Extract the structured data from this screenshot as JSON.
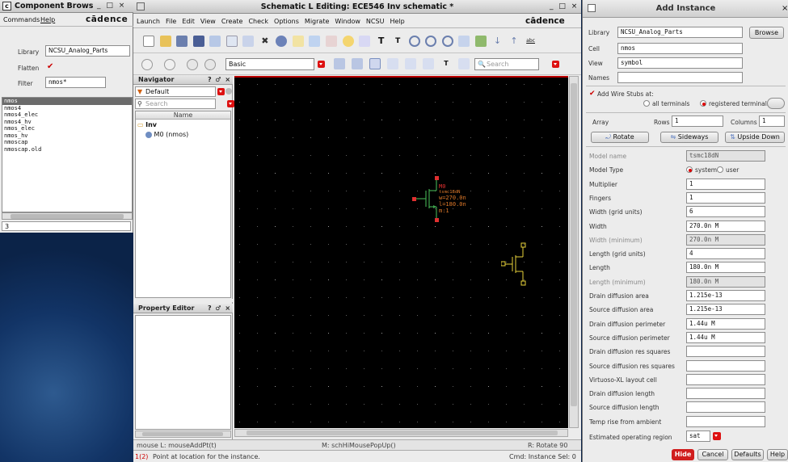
{
  "comp_browser": {
    "title": "Component Brows",
    "win_ctrls": "_ □ ×",
    "menu": [
      "Commands",
      "Help"
    ],
    "brand": "cādence",
    "library_label": "Library",
    "library_value": "NCSU_Analog_Parts",
    "flatten_label": "Flatten",
    "flatten_check": "✔",
    "filter_label": "Filter",
    "filter_value": "nmos*",
    "cells": [
      "nmos",
      "nmos4",
      "nmos4_elec",
      "nmos4_hv",
      "nmos_elec",
      "nmos_hv",
      "nmoscap",
      "nmoscap.old"
    ],
    "status_num": "3"
  },
  "main": {
    "title": "Schematic L Editing: ECE546 Inv schematic *",
    "win_ctrls": "_ □ ×",
    "menu": [
      "Launch",
      "File",
      "Edit",
      "View",
      "Create",
      "Check",
      "Options",
      "Migrate",
      "Window",
      "NCSU",
      "Help"
    ],
    "brand": "cādence",
    "toolbar2_combo": "Basic",
    "search_placeholder": "Search",
    "navigator_title": "Navigator",
    "navigator_ctrls": "? ♂ ×",
    "nav_filter": "Default",
    "nav_search": "Search",
    "nav_col": "Name",
    "tree_root": "Inv",
    "tree_child": "M0 (nmos)",
    "prop_editor_title": "Property Editor",
    "prop_editor_ctrls": "? ♂ ×",
    "status_left": "mouse L: mouseAddPt(t)",
    "status_mid": "M: schHiMousePopUp()",
    "status_right": "R: Rotate 90",
    "cmd_num": "1(2)",
    "cmd_prompt": "Point at location for the instance.",
    "cmd_instance": "Cmd: Instance  Sel: 0"
  },
  "instance": {
    "name": "M0",
    "model": "tsmc18dN",
    "w": "w=270.0n",
    "l": "l=180.0n",
    "m": "m:1"
  },
  "add_instance": {
    "title": "Add Instance",
    "close": "×",
    "library_label": "Library",
    "library_value": "NCSU_Analog_Parts",
    "browse": "Browse",
    "cell_label": "Cell",
    "cell_value": "nmos",
    "view_label": "View",
    "view_value": "symbol",
    "names_label": "Names",
    "wire_stubs_label": "Add Wire Stubs at:",
    "wire_opt1": "all terminals",
    "wire_opt2": "registered terminals only",
    "array_label": "Array",
    "rows_label": "Rows",
    "rows_value": "1",
    "cols_label": "Columns",
    "cols_value": "1",
    "rotate": "Rotate",
    "sideways": "Sideways",
    "upside_down": "Upside Down",
    "params": [
      {
        "label": "Model name",
        "value": "tsmc18dN",
        "ro": true,
        "dim": true
      },
      {
        "label": "Model Type",
        "value": "",
        "radio": [
          "system",
          "user"
        ]
      },
      {
        "label": "Multiplier",
        "value": "1"
      },
      {
        "label": "Fingers",
        "value": "1"
      },
      {
        "label": "Width (grid units)",
        "value": "6"
      },
      {
        "label": "Width",
        "value": "270.0n M"
      },
      {
        "label": "Width (minimum)",
        "value": "270.0n M",
        "ro": true,
        "dim": true
      },
      {
        "label": "Length (grid units)",
        "value": "4"
      },
      {
        "label": "Length",
        "value": "180.0n M"
      },
      {
        "label": "Length (minimum)",
        "value": "180.0n M",
        "ro": true,
        "dim": true
      },
      {
        "label": "Drain diffusion area",
        "value": "1.215e-13"
      },
      {
        "label": "Source diffusion area",
        "value": "1.215e-13"
      },
      {
        "label": "Drain diffusion perimeter",
        "value": "1.44u M"
      },
      {
        "label": "Source diffusion perimeter",
        "value": "1.44u M"
      },
      {
        "label": "Drain diffusion res squares",
        "value": ""
      },
      {
        "label": "Source diffusion res squares",
        "value": ""
      },
      {
        "label": "Virtuoso-XL layout cell",
        "value": ""
      },
      {
        "label": "Drain diffusion length",
        "value": ""
      },
      {
        "label": "Source diffusion length",
        "value": ""
      },
      {
        "label": "Temp rise from ambient",
        "value": ""
      }
    ],
    "op_region_label": "Estimated operating region",
    "op_region_value": "sat",
    "hide": "Hide",
    "cancel": "Cancel",
    "defaults": "Defaults",
    "help": "Help"
  },
  "colors": {
    "titlebar": "#cfcfcf",
    "canvas": "#000000",
    "accent_red": "#cc0000",
    "instance_green": "#3fa34d",
    "instance_red": "#e03030",
    "yellow": "#e8d23a"
  }
}
